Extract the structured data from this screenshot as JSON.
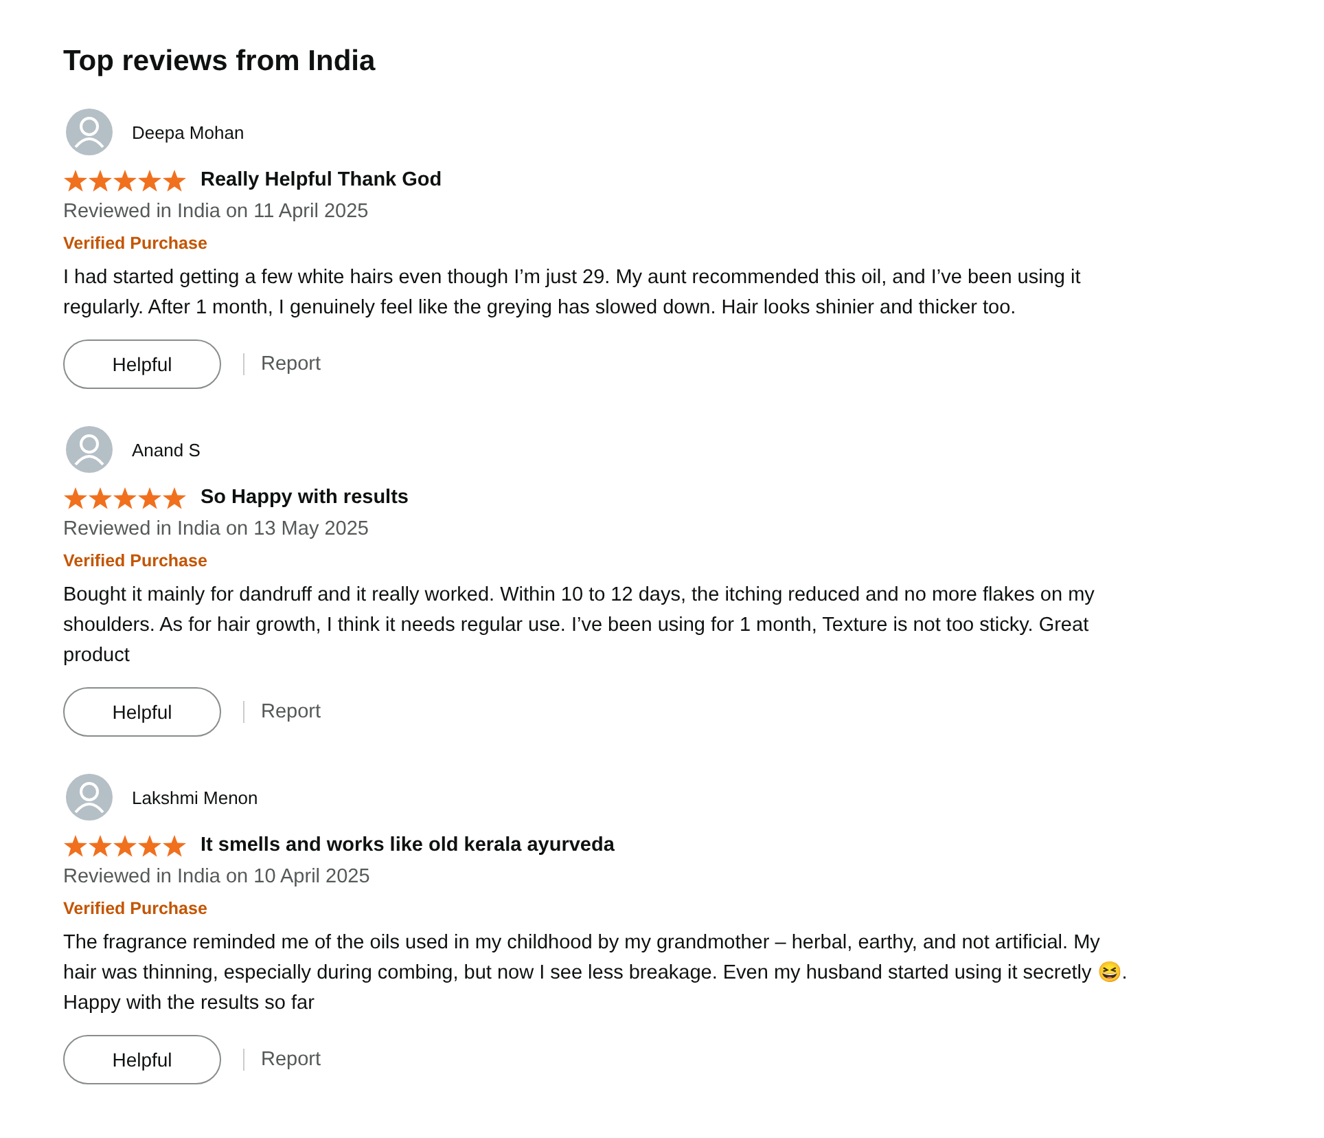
{
  "heading": "Top reviews from India",
  "reviews": [
    {
      "name": "Deepa Mohan",
      "stars": 5,
      "title": "Really Helpful Thank God",
      "date": "Reviewed in India on 11 April 2025",
      "badge": "Verified Purchase",
      "body": "I had started getting a few white hairs even though I’m just 29. My aunt recommended this oil, and I’ve been using it regularly. After 1 month, I genuinely feel like the greying has slowed down. Hair looks shinier and thicker too.",
      "helpful": "Helpful",
      "report": "Report"
    },
    {
      "name": "Anand S",
      "stars": 5,
      "title": "So Happy with results",
      "date": "Reviewed in India on 13 May 2025",
      "badge": "Verified Purchase",
      "body": "Bought it mainly for dandruff and it really worked. Within 10 to 12 days, the itching reduced and no more flakes on my shoulders. As for hair growth, I think it needs regular use. I’ve been using for 1 month, Texture is not too sticky. Great product",
      "helpful": "Helpful",
      "report": "Report"
    },
    {
      "name": "Lakshmi Menon",
      "stars": 5,
      "title": "It smells and works like old kerala ayurveda",
      "date": "Reviewed in India on 10 April 2025",
      "badge": "Verified Purchase",
      "body": "The fragrance reminded me of the oils used in my childhood by my grandmother – herbal, earthy, and not artificial. My hair was thinning, especially during combing, but now I see less breakage. Even my husband started using it secretly 😆. Happy with the results so far",
      "helpful": "Helpful",
      "report": "Report"
    }
  ]
}
